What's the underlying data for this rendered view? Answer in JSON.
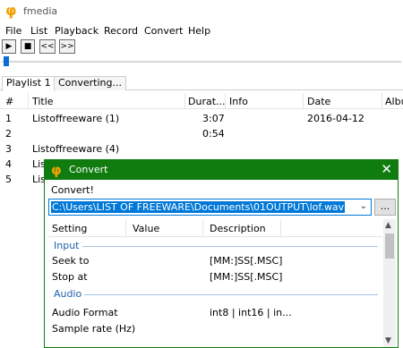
{
  "app": {
    "title": "fmedia",
    "logo_glyph": "φ"
  },
  "menu": [
    "File",
    "List",
    "Playback",
    "Record",
    "Convert",
    "Help"
  ],
  "toolbar": {
    "play": "▶",
    "stop": "■",
    "prev": "<<",
    "next": ">>"
  },
  "tabs": [
    "Playlist 1",
    "Converting..."
  ],
  "playlist": {
    "columns": [
      "#",
      "Title",
      "Durat...",
      "Info",
      "Date",
      "Albu"
    ],
    "rows": [
      {
        "num": "1",
        "title": "Listoffreeware (1)",
        "duration": "3:07",
        "info": "",
        "date": "2016-04-12"
      },
      {
        "num": "2",
        "title": "",
        "duration": "0:54",
        "info": "",
        "date": ""
      },
      {
        "num": "3",
        "title": "Listoffreeware (4)",
        "duration": "",
        "info": "",
        "date": ""
      },
      {
        "num": "4",
        "title": "Lis",
        "duration": "",
        "info": "",
        "date": ""
      },
      {
        "num": "5",
        "title": "Lis",
        "duration": "",
        "info": "",
        "date": ""
      }
    ]
  },
  "dialog": {
    "icon_glyph": "φ",
    "title": "Convert",
    "close": "✕",
    "subtitle": "Convert!",
    "output_path": "C:\\Users\\LIST OF FREEWARE\\Documents\\01OUTPUT\\lof.wav",
    "browse_label": "...",
    "dropdown_glyph": "⌄",
    "grid": {
      "columns": [
        "Setting",
        "Value",
        "Description"
      ],
      "groups": [
        {
          "name": "Input",
          "rows": [
            {
              "setting": "Seek to",
              "value": "",
              "description": "[MM:]SS[.MSC]"
            },
            {
              "setting": "Stop at",
              "value": "",
              "description": "[MM:]SS[.MSC]"
            }
          ]
        },
        {
          "name": "Audio",
          "rows": [
            {
              "setting": "Audio Format",
              "value": "",
              "description": "int8 | int16 | in..."
            },
            {
              "setting": "Sample rate (Hz)",
              "value": "",
              "description": ""
            }
          ]
        }
      ]
    },
    "scroll": {
      "up": "▲",
      "down": "▼"
    }
  },
  "colors": {
    "accent": "#107c10",
    "selection": "#0078d7",
    "logo": "#f2a100"
  }
}
